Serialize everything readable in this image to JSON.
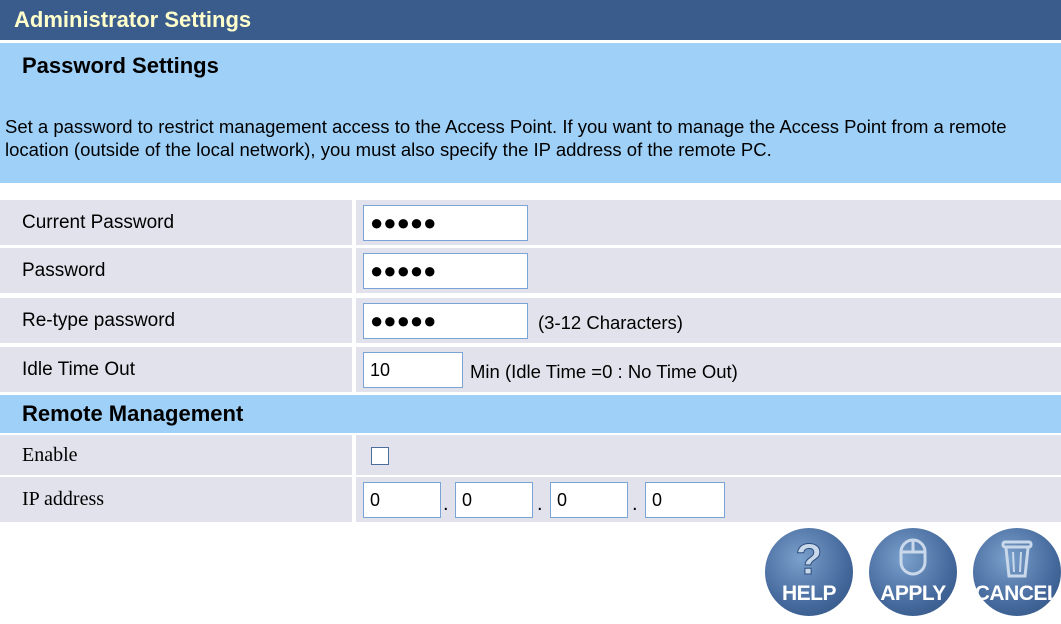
{
  "header": {
    "title": "Administrator Settings"
  },
  "password_section": {
    "title": "Password Settings",
    "description": "Set a password to restrict management access to the Access Point. If you want to manage the Access Point from a remote location (outside of the local network), you must also specify the IP address of the remote PC.",
    "fields": {
      "current_password": {
        "label": "Current Password",
        "value": "●●●●●"
      },
      "password": {
        "label": "Password",
        "value": "●●●●●"
      },
      "retype_password": {
        "label": "Re-type password",
        "value": "●●●●●",
        "hint": "(3-12 Characters)"
      },
      "idle_time_out": {
        "label": "Idle Time Out",
        "value": "10",
        "hint": "Min (Idle Time =0 : No Time Out)"
      }
    }
  },
  "remote_section": {
    "title": "Remote Management",
    "enable": {
      "label": "Enable",
      "checked": false
    },
    "ip_address": {
      "label": "IP address",
      "octets": [
        "0",
        "0",
        "0",
        "0"
      ],
      "separator": "."
    }
  },
  "buttons": {
    "help": "HELP",
    "apply": "APPLY",
    "cancel": "CANCEL"
  },
  "colors": {
    "title_bar": "#3a5c8c",
    "title_text": "#ffffcc",
    "section_header": "#9fd0f8",
    "row_background": "#e2e2ec",
    "input_border": "#7aa3d6"
  },
  "icons": {
    "help": "question-mark-icon",
    "apply": "mouse-icon",
    "cancel": "trash-can-icon"
  }
}
